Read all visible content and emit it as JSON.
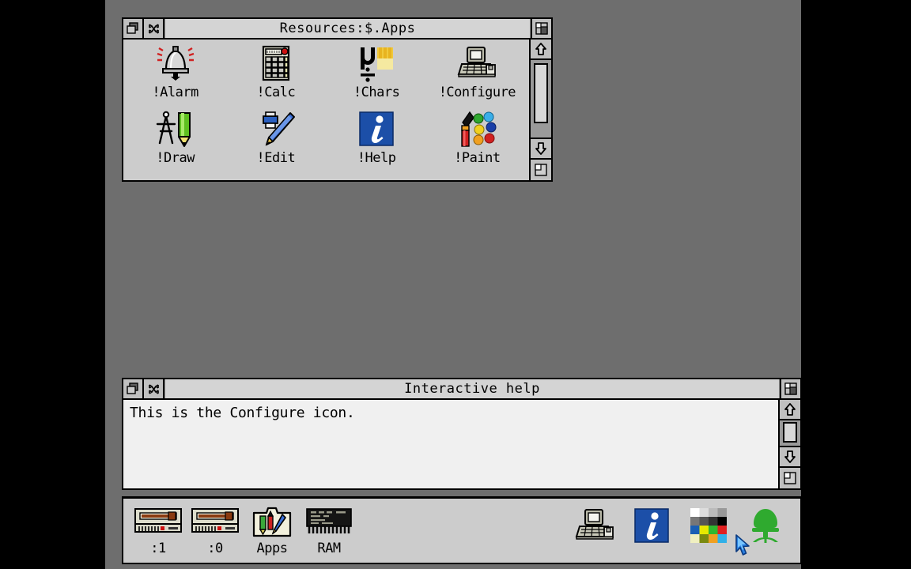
{
  "desktop": {
    "background_color": "#6e6e6e",
    "letterbox_color": "#000000",
    "face_color": "#cccccc"
  },
  "apps_window": {
    "title": "Resources:$.Apps",
    "gadgets": {
      "back": "back-icon",
      "close": "close-icon",
      "toggle_size": "toggle-size-icon",
      "scroll_up": "up-arrow-icon",
      "scroll_down": "down-arrow-icon",
      "resize": "resize-icon"
    },
    "icons": [
      {
        "label": "!Alarm",
        "icon": "alarm-bell-icon"
      },
      {
        "label": "!Calc",
        "icon": "calculator-icon"
      },
      {
        "label": "!Chars",
        "icon": "characters-icon"
      },
      {
        "label": "!Configure",
        "icon": "configure-computer-icon"
      },
      {
        "label": "!Draw",
        "icon": "draw-compass-pencil-icon"
      },
      {
        "label": "!Edit",
        "icon": "edit-pen-printer-icon"
      },
      {
        "label": "!Help",
        "icon": "help-info-icon"
      },
      {
        "label": "!Paint",
        "icon": "paint-brush-palette-icon"
      }
    ]
  },
  "help_window": {
    "title": "Interactive help",
    "body_text": "This is the Configure icon.",
    "gadgets": {
      "back": "back-icon",
      "close": "close-icon",
      "toggle_size": "toggle-size-icon",
      "scroll_up": "up-arrow-icon",
      "scroll_down": "down-arrow-icon",
      "resize": "resize-icon"
    }
  },
  "icon_bar": {
    "left_items": [
      {
        "label": ":1",
        "icon": "floppy-drive-icon"
      },
      {
        "label": ":0",
        "icon": "floppy-drive-icon"
      },
      {
        "label": "Apps",
        "icon": "apps-folder-icon"
      },
      {
        "label": "RAM",
        "icon": "ram-chip-icon"
      }
    ],
    "right_items": [
      {
        "label": "",
        "icon": "configure-computer-icon"
      },
      {
        "label": "",
        "icon": "help-info-icon"
      },
      {
        "label": "",
        "icon": "palette-icon"
      },
      {
        "label": "",
        "icon": "acorn-logo-icon"
      }
    ]
  },
  "pointer": {
    "icon": "arrow-pointer-icon",
    "color": "#1a5fd0"
  },
  "palette_colors": [
    [
      "#ffffff",
      "#dddddd",
      "#bbbbbb",
      "#999999"
    ],
    [
      "#777777",
      "#555555",
      "#333333",
      "#000000"
    ],
    [
      "#1a5fb4",
      "#e8e800",
      "#2fb82f",
      "#e02020"
    ],
    [
      "#f0f0c0",
      "#7a8a10",
      "#f0a020",
      "#30b0e8"
    ]
  ]
}
